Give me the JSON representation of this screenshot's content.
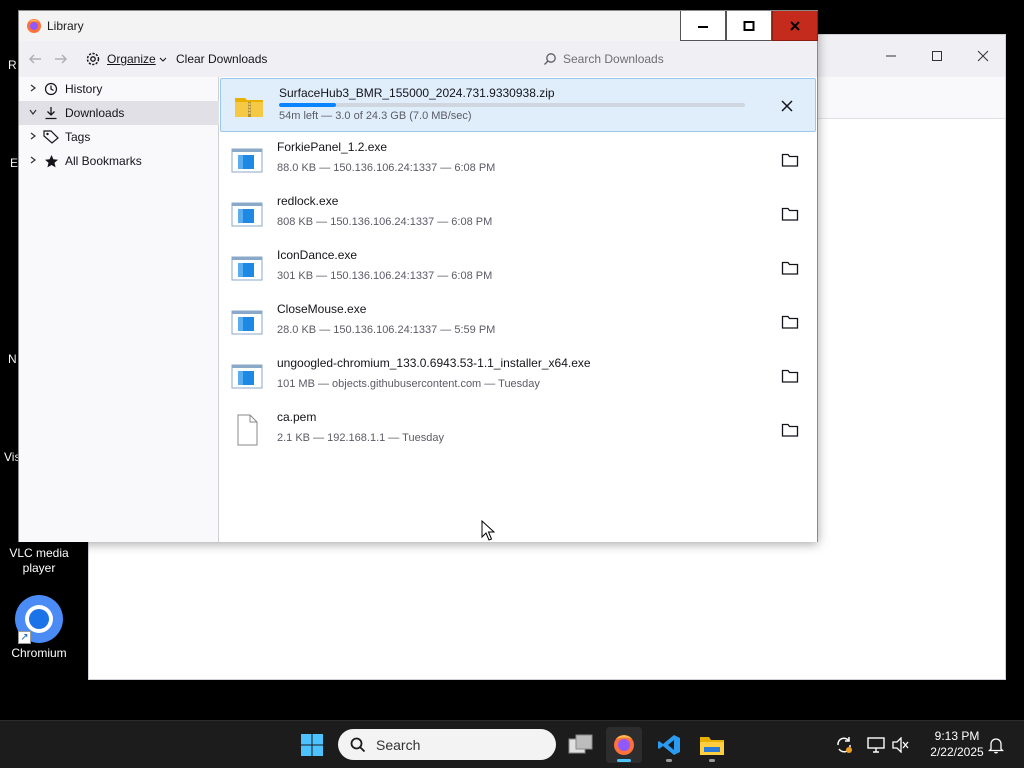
{
  "desktop": {
    "icons": [
      {
        "label": "VLC media player"
      },
      {
        "label": "Chromium"
      }
    ],
    "edge_fragments": [
      "R",
      "E",
      "N",
      "Vis"
    ]
  },
  "library": {
    "title": "Library",
    "toolbar": {
      "organize_label": "Organize",
      "clear_downloads_label": "Clear Downloads",
      "search_placeholder": "Search Downloads"
    },
    "sidebar": {
      "items": [
        {
          "label": "History",
          "icon": "history-icon"
        },
        {
          "label": "Downloads",
          "icon": "download-icon",
          "selected": true
        },
        {
          "label": "Tags",
          "icon": "tag-icon"
        },
        {
          "label": "All Bookmarks",
          "icon": "star-icon"
        }
      ]
    },
    "downloads": [
      {
        "name": "SurfaceHub3_BMR_155000_2024.731.9330938.zip",
        "status": "54m left — 3.0 of 24.3 GB (7.0 MB/sec)",
        "in_progress": true,
        "progress": 0.123,
        "icon": "zip-file-icon"
      },
      {
        "name": "ForkiePanel_1.2.exe",
        "status": "88.0 KB — 150.136.106.24:1337 — 6:08 PM",
        "icon": "exe-file-icon"
      },
      {
        "name": "redlock.exe",
        "status": "808 KB — 150.136.106.24:1337 — 6:08 PM",
        "icon": "exe-file-icon"
      },
      {
        "name": "IconDance.exe",
        "status": "301 KB — 150.136.106.24:1337 — 6:08 PM",
        "icon": "exe-file-icon"
      },
      {
        "name": "CloseMouse.exe",
        "status": "28.0 KB — 150.136.106.24:1337 — 5:59 PM",
        "icon": "exe-file-icon"
      },
      {
        "name": "ungoogled-chromium_133.0.6943.53-1.1_installer_x64.exe",
        "status": "101 MB — objects.githubusercontent.com — Tuesday",
        "icon": "exe-file-icon"
      },
      {
        "name": "ca.pem",
        "status": "2.1 KB — 192.168.1.1 — Tuesday",
        "icon": "blank-file-icon"
      }
    ]
  },
  "taskbar": {
    "search_label": "Search",
    "clock": {
      "time": "9:13 PM",
      "date": "2/22/2025"
    }
  },
  "colors": {
    "accent": "#0a84ff",
    "close_red": "#c42b1c",
    "taskbar_bg": "#1c1c1c",
    "active_row_bg": "#e0eefc"
  }
}
